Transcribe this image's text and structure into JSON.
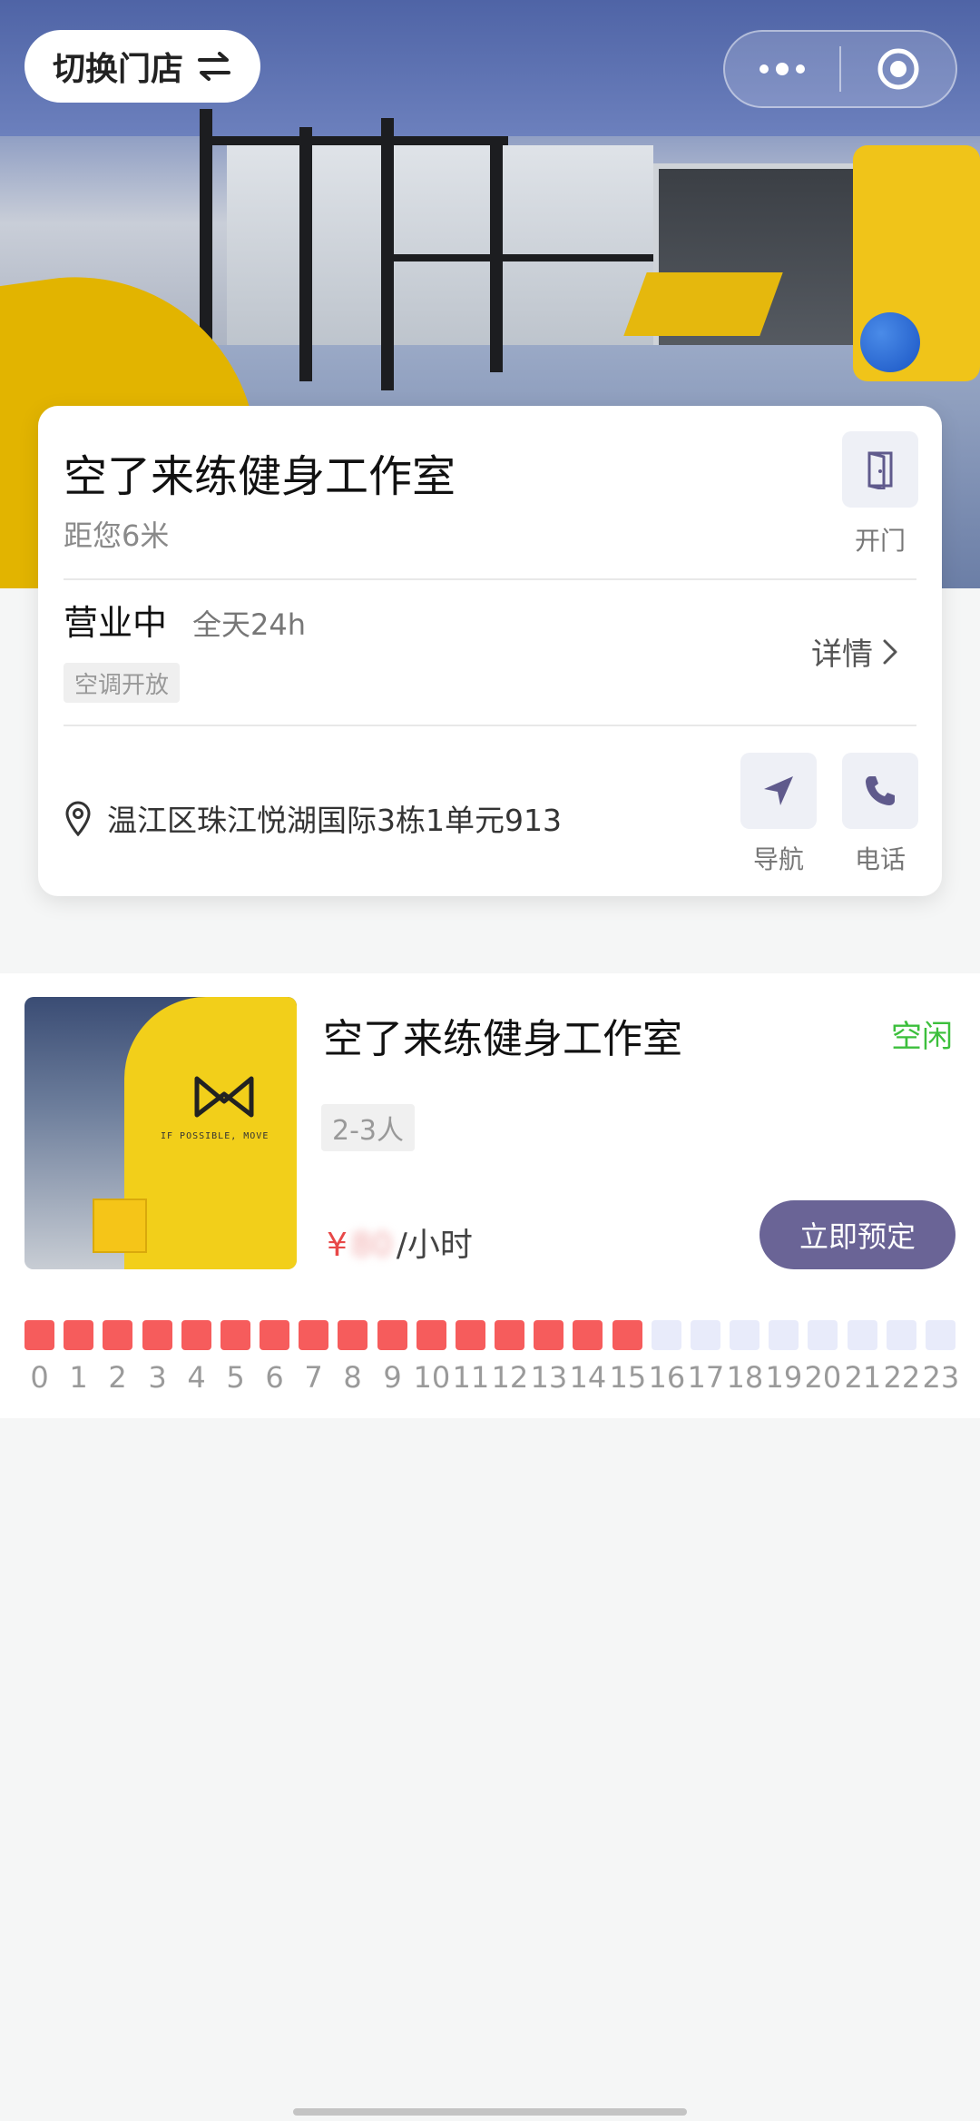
{
  "header": {
    "switch_store_label": "切换门店",
    "switch_icon": "swap-arrows-icon",
    "more_icon": "more-dots-icon",
    "close_icon": "target-circle-icon"
  },
  "store": {
    "name": "空了来练健身工作室",
    "distance": "距您6米",
    "door_label": "开门",
    "status": "营业中",
    "hours": "全天24h",
    "tag": "空调开放",
    "details_label": "详情",
    "address": "温江区珠江悦湖国际3栋1单元913",
    "nav_label": "导航",
    "phone_label": "电话"
  },
  "room": {
    "name": "空了来练健身工作室",
    "status": "空闲",
    "capacity": "2-3人",
    "currency": "¥",
    "price": "80",
    "unit": "/小时",
    "book_label": "立即预定",
    "photo_logo_text": "IF POSSIBLE, MOVE",
    "hours": [
      {
        "label": "0",
        "busy": true
      },
      {
        "label": "1",
        "busy": true
      },
      {
        "label": "2",
        "busy": true
      },
      {
        "label": "3",
        "busy": true
      },
      {
        "label": "4",
        "busy": true
      },
      {
        "label": "5",
        "busy": true
      },
      {
        "label": "6",
        "busy": true
      },
      {
        "label": "7",
        "busy": true
      },
      {
        "label": "8",
        "busy": true
      },
      {
        "label": "9",
        "busy": true
      },
      {
        "label": "10",
        "busy": true
      },
      {
        "label": "11",
        "busy": true
      },
      {
        "label": "12",
        "busy": true
      },
      {
        "label": "13",
        "busy": true
      },
      {
        "label": "14",
        "busy": true
      },
      {
        "label": "15",
        "busy": true
      },
      {
        "label": "16",
        "busy": false
      },
      {
        "label": "17",
        "busy": false
      },
      {
        "label": "18",
        "busy": false
      },
      {
        "label": "19",
        "busy": false
      },
      {
        "label": "20",
        "busy": false
      },
      {
        "label": "21",
        "busy": false
      },
      {
        "label": "22",
        "busy": false
      },
      {
        "label": "23",
        "busy": false
      }
    ]
  },
  "colors": {
    "accent": "#6a6496",
    "busy": "#f65c5c",
    "free": "#e8ebfa",
    "idle_status": "#3cbf3c",
    "price": "#e84848"
  }
}
